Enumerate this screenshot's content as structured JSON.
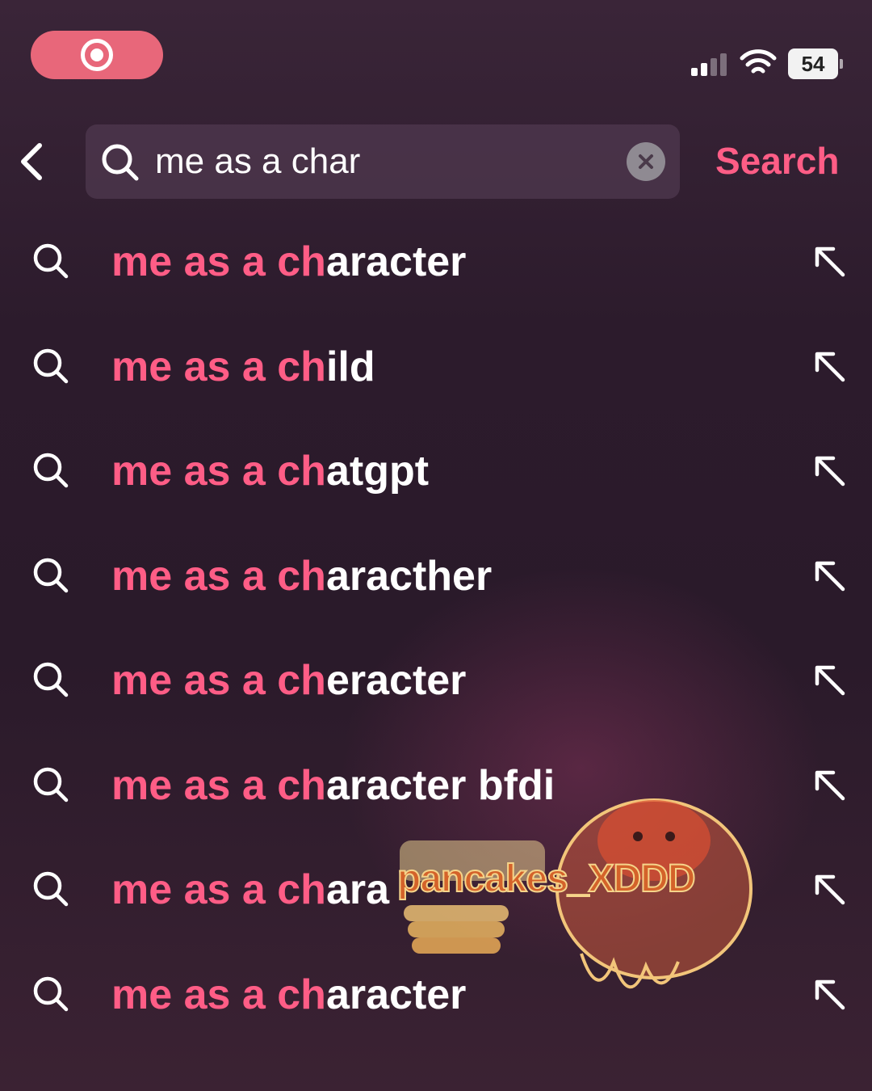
{
  "status_bar": {
    "battery": "54",
    "icons": [
      "screen-record-icon",
      "cellular-signal-icon",
      "wifi-icon",
      "battery-icon"
    ]
  },
  "search": {
    "query": "me as a char",
    "action_label": "Search",
    "icons": [
      "back-chevron-icon",
      "search-icon",
      "clear-icon"
    ]
  },
  "suggestions": [
    {
      "match": "me as a ch",
      "rest": "aracter"
    },
    {
      "match": "me as a ch",
      "rest": "ild"
    },
    {
      "match": "me as a ch",
      "rest": "atgpt"
    },
    {
      "match": "me as a ch",
      "rest": "aracther"
    },
    {
      "match": "me as a ch",
      "rest": "eracter"
    },
    {
      "match": "me as a ch",
      "rest": "aracter bfdi"
    },
    {
      "match": "me as a ch",
      "rest": "ara"
    },
    {
      "match": "me as a ch",
      "rest": "aracter"
    }
  ],
  "watermark": {
    "text": "pancakes_XDDD"
  },
  "colors": {
    "accent": "#ff5d86",
    "record_pill": "#e8677a",
    "background": "#2c1b2c"
  }
}
